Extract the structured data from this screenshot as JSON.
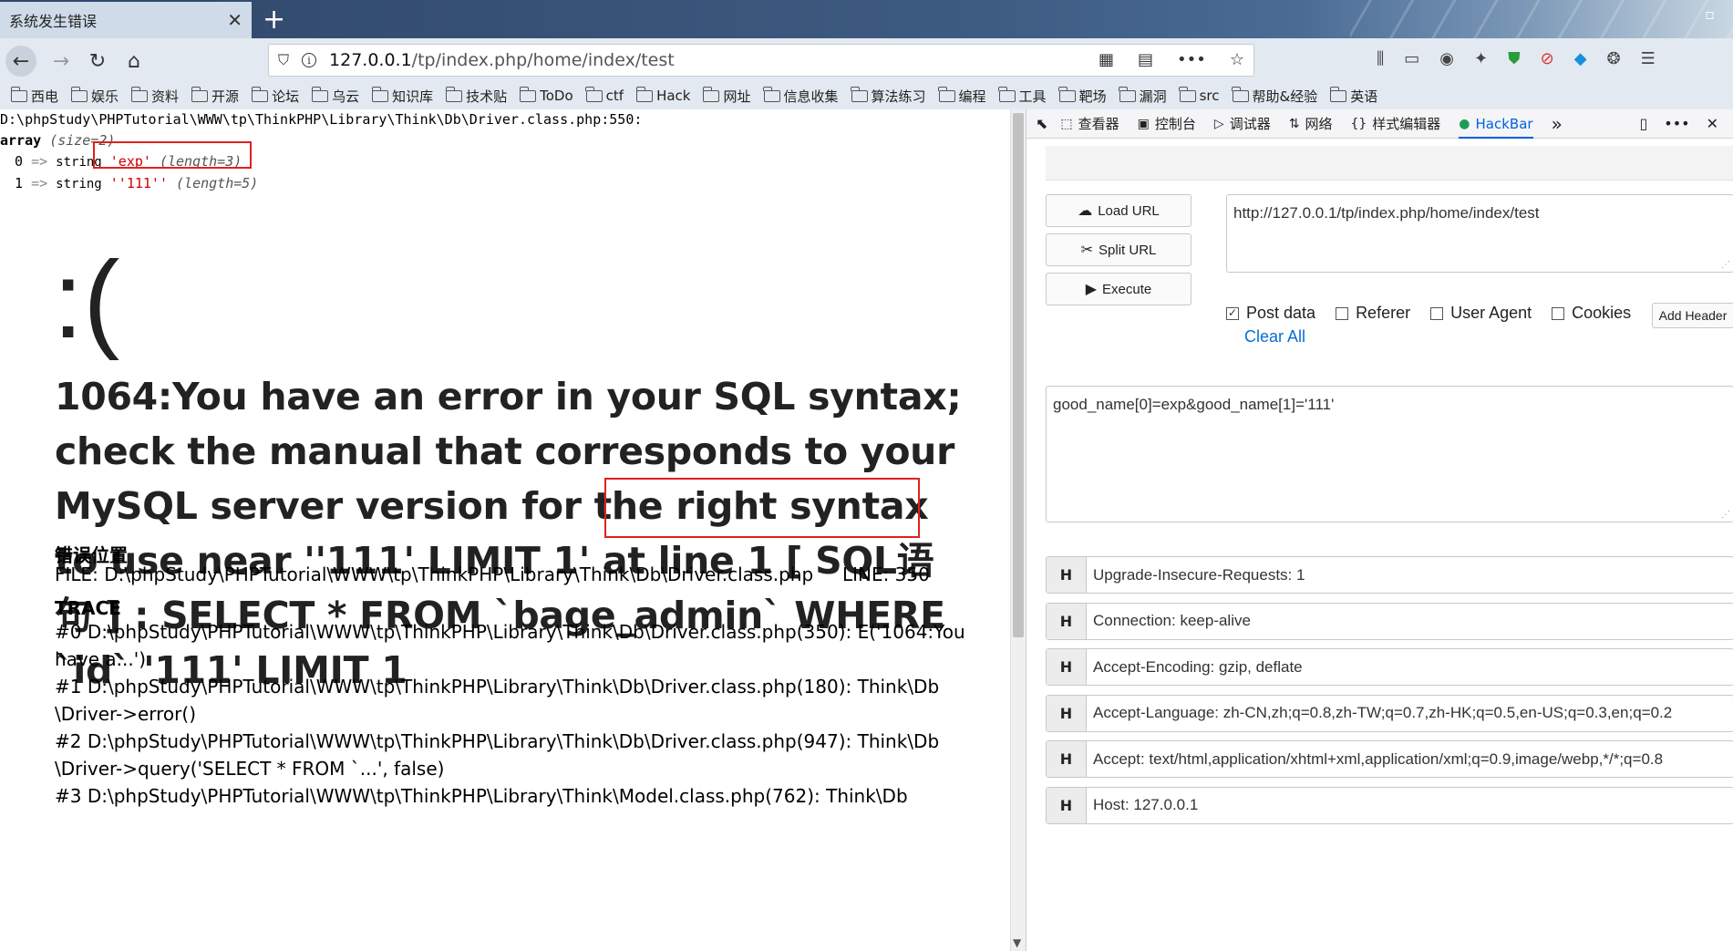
{
  "tab": {
    "title": "系统发生错误",
    "close": "✕",
    "new_tab": "+"
  },
  "nav": {
    "back": "←",
    "forward": "→",
    "reload": "↻",
    "home": "⌂",
    "url_host": "127.0.0.1",
    "url_path": "/tp/index.php/home/index/test",
    "url_icons": [
      "qr-icon",
      "reader-icon",
      "more-icon",
      "star-icon"
    ]
  },
  "bookmarks": [
    "西电",
    "娱乐",
    "资料",
    "开源",
    "论坛",
    "乌云",
    "知识库",
    "技术贴",
    "ToDo",
    "ctf",
    "Hack",
    "网址",
    "信息收集",
    "算法练习",
    "编程",
    "工具",
    "靶场",
    "漏洞",
    "src",
    "帮助&经验",
    "英语"
  ],
  "debug": {
    "path": "D:\\phpStudy\\PHPTutorial\\WWW\\tp\\ThinkPHP\\Library\\Think\\Db\\Driver.class.php:550:",
    "array_kw": "array",
    "array_size": "(size=2)",
    "rows": [
      {
        "idx": "0",
        "arrow": "=>",
        "type": "string",
        "value": "'exp'",
        "len": "(length=3)"
      },
      {
        "idx": "1",
        "arrow": "=>",
        "type": "string",
        "value": "''111''",
        "len": "(length=5)"
      }
    ]
  },
  "error": {
    "face": ":(",
    "message": "1064:You have an error in your SQL syntax; check the manual that corresponds to your MySQL server version for the right syntax to use near ''111' LIMIT 1' at line 1 [ SQL语句 ] : SELECT * FROM `bage_admin` WHERE `id` '111' LIMIT 1",
    "location_title": "错误位置",
    "file_line": "FILE: D:\\phpStudy\\PHPTutorial\\WWW\\tp\\ThinkPHP\\Library\\Think\\Db\\Driver.class.php     LINE: 350",
    "trace_title": "TRACE",
    "trace": [
      "#0 D:\\phpStudy\\PHPTutorial\\WWW\\tp\\ThinkPHP\\Library\\Think\\Db\\Driver.class.php(350): E('1064:You",
      "have a...')",
      "#1 D:\\phpStudy\\PHPTutorial\\WWW\\tp\\ThinkPHP\\Library\\Think\\Db\\Driver.class.php(180): Think\\Db",
      "\\Driver->error()",
      "#2 D:\\phpStudy\\PHPTutorial\\WWW\\tp\\ThinkPHP\\Library\\Think\\Db\\Driver.class.php(947): Think\\Db",
      "\\Driver->query('SELECT * FROM `...', false)",
      "#3 D:\\phpStudy\\PHPTutorial\\WWW\\tp\\ThinkPHP\\Library\\Think\\Model.class.php(762): Think\\Db"
    ]
  },
  "devtools": {
    "tabs": [
      {
        "icon": "⬚",
        "label": "查看器"
      },
      {
        "icon": "▣",
        "label": "控制台"
      },
      {
        "icon": "▷",
        "label": "调试器"
      },
      {
        "icon": "⇅",
        "label": "网络"
      },
      {
        "icon": "{}",
        "label": "样式编辑器"
      },
      {
        "icon": "●",
        "label": "HackBar"
      }
    ],
    "more": "»"
  },
  "hackbar": {
    "load_url": "Load URL",
    "split_url": "Split URL",
    "execute": "Execute",
    "url_value": "http://127.0.0.1/tp/index.php/home/index/test",
    "options": [
      {
        "label": "Post data",
        "checked": "✓"
      },
      {
        "label": "Referer",
        "checked": ""
      },
      {
        "label": "User Agent",
        "checked": ""
      },
      {
        "label": "Cookies",
        "checked": ""
      }
    ],
    "add_header": "Add Header",
    "clear_all": "Clear All",
    "post_value": "good_name[0]=exp&good_name[1]='111'",
    "headers": [
      {
        "h": "H",
        "v": "Upgrade-Insecure-Requests: 1"
      },
      {
        "h": "H",
        "v": "Connection: keep-alive"
      },
      {
        "h": "H",
        "v": "Accept-Encoding: gzip, deflate"
      },
      {
        "h": "H",
        "v": "Accept-Language: zh-CN,zh;q=0.8,zh-TW;q=0.7,zh-HK;q=0.5,en-US;q=0.3,en;q=0.2"
      },
      {
        "h": "H",
        "v": "Accept: text/html,application/xhtml+xml,application/xml;q=0.9,image/webp,*/*;q=0.8"
      },
      {
        "h": "H",
        "v": "Host: 127.0.0.1"
      }
    ]
  }
}
